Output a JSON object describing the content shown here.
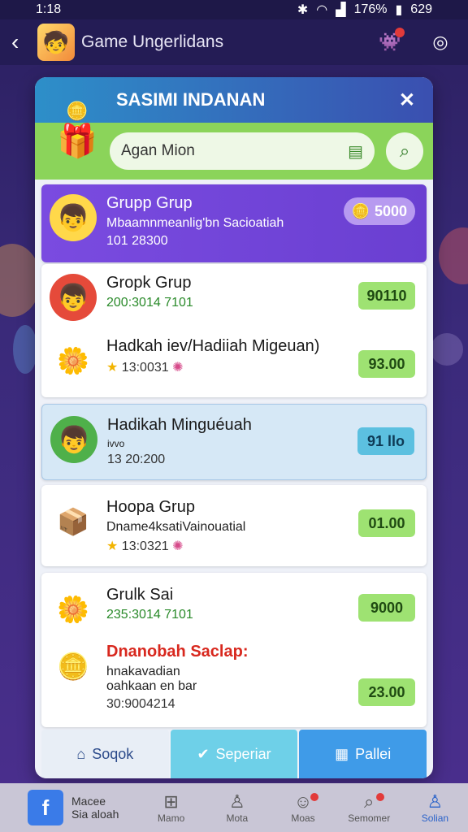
{
  "status": {
    "time": "1:18",
    "battery": "176%",
    "clock_right": "629"
  },
  "appbar": {
    "title": "Game Ungerlidans"
  },
  "panel": {
    "title": "SASIMI INDANAN",
    "search": {
      "value": "Agan Mion"
    }
  },
  "rows": [
    {
      "title": "Grupp Grup",
      "sub": "Mbaamnmeanlig'bn Sacioatiah",
      "meta": "101 28300",
      "badge": "5000",
      "variant": "purple"
    },
    {
      "title": "Gropk Grup",
      "meta": "200:3014 7101",
      "badge": "90110"
    },
    {
      "title": "Hadkah iev/Hadiiah Migeuan)",
      "meta": "13:0031",
      "badge": "93.00"
    },
    {
      "title": "Hadikah Minguéuah",
      "sub": "ivvo",
      "meta": "13 20:200",
      "badge": "91 llo",
      "variant": "blue"
    },
    {
      "title": "Hoopa Grup",
      "sub": "Dname4ksatiVainouatial",
      "meta": "13:0321",
      "badge": "01.00"
    },
    {
      "title": "Grulk Sai",
      "meta": "235:3014 7101",
      "badge": "9000"
    },
    {
      "title": "Dnanobah Saclap:",
      "sub": "hnakavadian",
      "sub2": "oahkaan en bar",
      "meta": "30:9004214",
      "badge": "23.00"
    }
  ],
  "tabs": [
    {
      "label": "Soqok"
    },
    {
      "label": "Seperiar"
    },
    {
      "label": "Pallei"
    }
  ],
  "bottomnav": {
    "brand": [
      "Macee",
      "Sia aloah"
    ],
    "items": [
      {
        "label": "Mamo"
      },
      {
        "label": "Mota"
      },
      {
        "label": "Moas"
      },
      {
        "label": "Semomer"
      },
      {
        "label": "Solian"
      }
    ]
  },
  "colors": {
    "accent_green": "#9ee272",
    "purple": "#7a4be0",
    "header_blue": "#2d8fc9"
  }
}
